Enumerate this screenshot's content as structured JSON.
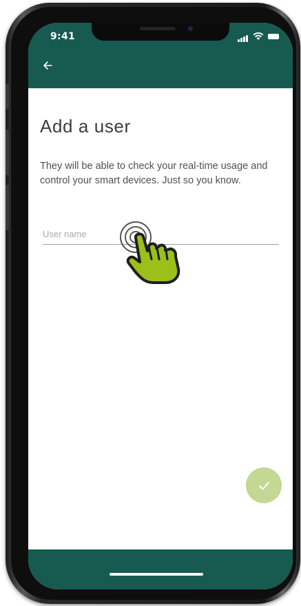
{
  "status_bar": {
    "time": "9:41"
  },
  "header": {
    "back_icon": "arrow-left-icon"
  },
  "main": {
    "title": "Add a user",
    "description": "They will be able to check your real-time usage and control your smart devices. Just so you know.",
    "username_placeholder": "User name",
    "username_value": ""
  },
  "actions": {
    "submit_icon": "check-icon"
  },
  "colors": {
    "primary": "#165a50",
    "accent": "#c5d893",
    "hand": "#9cbf1a"
  }
}
